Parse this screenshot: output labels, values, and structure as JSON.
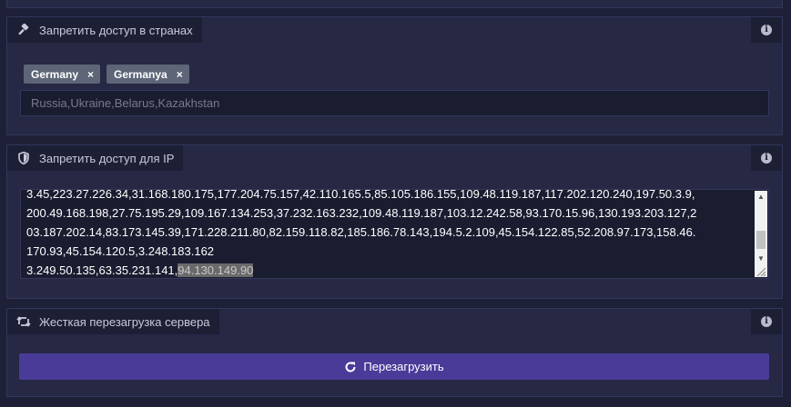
{
  "countries_panel": {
    "title": "Запретить доступ в странах",
    "icon": "gavel-icon",
    "tags": [
      {
        "label": "Germany"
      },
      {
        "label": "Germanya"
      }
    ],
    "tag_remove_glyph": "×",
    "input_placeholder": "Russia,Ukraine,Belarus,Kazakhstan"
  },
  "ip_panel": {
    "title": "Запретить доступ для IP",
    "icon": "shield-icon",
    "text_lines": [
      "3.45,223.27.226.34,31.168.180.175,177.204.75.157,42.110.165.5,85.105.186.155,109.48.119.187,117.202.120.240,197.50.3.9,",
      "200.49.168.198,27.75.195.29,109.167.134.253,37.232.163.232,109.48.119.187,103.12.242.58,93.170.15.96,130.193.203.127,2",
      "03.187.202.14,83.173.145.39,171.228.211.80,82.159.118.82,185.186.78.143,194.5.2.109,45.154.122.85,52.208.97.173,158.46.",
      "170.93,45.154.120.5,3.248.183.162"
    ],
    "last_line_plain": "3.249.50.135,63.35.231.141,",
    "last_line_selected": "94.130.149.90"
  },
  "reboot_panel": {
    "title": "Жесткая перезагрузка сервера",
    "icon": "retweet-icon",
    "button_label": "Перезагрузить",
    "button_icon": "refresh-icon"
  },
  "info_icon": "info-icon",
  "colors": {
    "background": "#1e2037",
    "panel": "#262844",
    "header": "#1d1f35",
    "accent_button": "#4a3b99",
    "tag": "#5d6577"
  }
}
